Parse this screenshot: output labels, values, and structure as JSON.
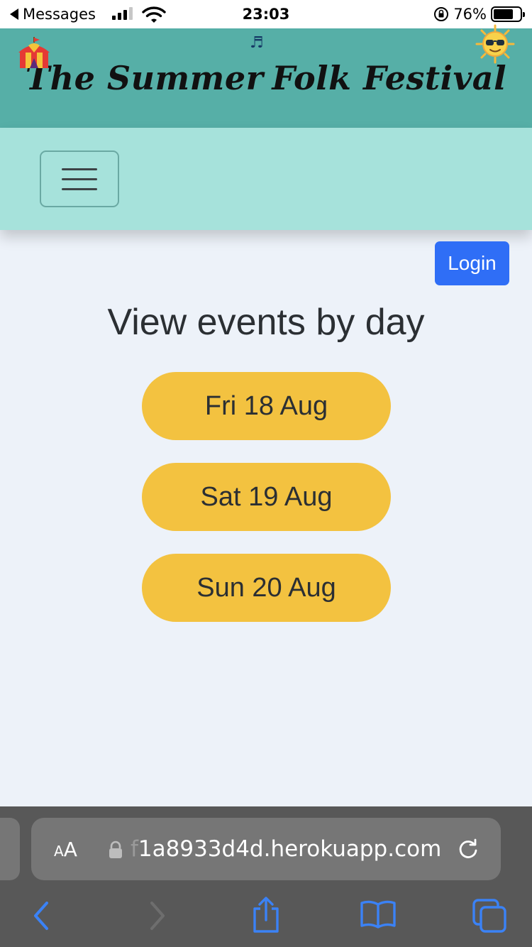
{
  "status_bar": {
    "back_app": "Messages",
    "time": "23:03",
    "battery": "76%",
    "battery_level": 0.76,
    "signal_bars_on": 3,
    "signal_bars_total": 4
  },
  "header": {
    "title_part1": "The Summer",
    "title_part2": "Folk Festival",
    "icons": [
      "circus-tent-icon",
      "music-note-icon",
      "sun-sunglasses-icon"
    ]
  },
  "navbar": {
    "toggle_icon": "hamburger-menu-icon"
  },
  "main": {
    "login_label": "Login",
    "section_title": "View events by day",
    "days": [
      {
        "label": "Fri 18 Aug"
      },
      {
        "label": "Sat 19 Aug"
      },
      {
        "label": "Sun 20 Aug"
      }
    ]
  },
  "browser": {
    "aa_small": "A",
    "aa_big": "A",
    "url_faded": "f",
    "url_rest": "1a8933d4d.herokuapp.com",
    "toolbar_icons": [
      "back-icon",
      "forward-icon",
      "share-icon",
      "bookmarks-icon",
      "tabs-icon"
    ]
  },
  "colors": {
    "header_bg": "#56afa7",
    "navbar_bg": "#a6e2db",
    "page_bg": "#edf2f9",
    "login_bg": "#2f6ef6",
    "day_button_bg": "#f3c240",
    "browser_bar_bg": "#585858",
    "ios_blue": "#3b82f6"
  }
}
